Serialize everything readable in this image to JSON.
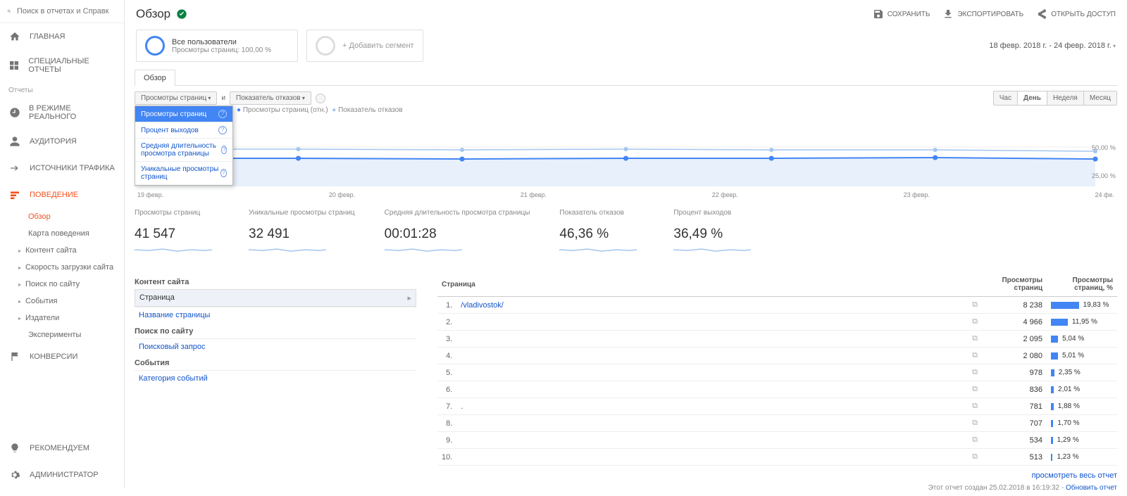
{
  "search_placeholder": "Поиск в отчетах и Справк",
  "sidebar": {
    "home": "ГЛАВНАЯ",
    "custom": "СПЕЦИАЛЬНЫЕ ОТЧЕТЫ",
    "reports_label": "Отчеты",
    "realtime": "В РЕЖИМЕ РЕАЛЬНОГО",
    "audience": "АУДИТОРИЯ",
    "acquisition": "ИСТОЧНИКИ ТРАФИКА",
    "behavior": "ПОВЕДЕНИЕ",
    "conversions": "КОНВЕРСИИ",
    "discover": "РЕКОМЕНДУЕМ",
    "admin": "АДМИНИСТРАТОР",
    "sub": {
      "overview": "Обзор",
      "flow": "Карта поведения",
      "content": "Контент сайта",
      "speed": "Скорость загрузки сайта",
      "search": "Поиск по сайту",
      "events": "События",
      "publisher": "Издатели",
      "experiments": "Эксперименты"
    }
  },
  "page_title": "Обзор",
  "actions": {
    "save": "СОХРАНИТЬ",
    "export": "ЭКСПОРТИРОВАТЬ",
    "share": "ОТКРЫТЬ ДОСТУП"
  },
  "segment": {
    "all_users": "Все пользователи",
    "sub": "Просмотры страниц: 100,00 %",
    "add": "+ Добавить сегмент"
  },
  "date_range": "18 февр. 2018 г. - 24 февр. 2018 г.",
  "tab": "Обзор",
  "metric1": "Просмотры страниц",
  "and": "и",
  "metric2": "Показатель отказов",
  "dropdown": [
    "Просмотры страниц",
    "Процент выходов",
    "Средняя длительность просмотра страницы",
    "Уникальные просмотры страниц"
  ],
  "granularity": {
    "hour": "Час",
    "day": "День",
    "week": "Неделя",
    "month": "Месяц"
  },
  "chart_legend": "Показатель отказов",
  "y_labels": {
    "top": "50,00 %",
    "mid": "25,00 %"
  },
  "chart_data": {
    "type": "line",
    "x": [
      "19 февр.",
      "20 февр.",
      "21 февр.",
      "22 февр.",
      "23 февр.",
      "24 фе."
    ],
    "series": [
      {
        "name": "Просмотры страниц (отн.)",
        "values": [
          36,
          36,
          35,
          36,
          36,
          37,
          35
        ],
        "color": "#4285f4"
      },
      {
        "name": "Показатель отказов, %",
        "values": [
          47,
          47,
          46,
          47,
          46,
          46,
          45
        ],
        "color": "#a3c7f0",
        "ylim": [
          0,
          100
        ]
      }
    ]
  },
  "scorecards": [
    {
      "label": "Просмотры страниц",
      "value": "41 547"
    },
    {
      "label": "Уникальные просмотры страниц",
      "value": "32 491"
    },
    {
      "label": "Средняя длительность просмотра страницы",
      "value": "00:01:28"
    },
    {
      "label": "Показатель отказов",
      "value": "46,36 %"
    },
    {
      "label": "Процент выходов",
      "value": "36,49 %"
    }
  ],
  "left": {
    "content_hd": "Контент сайта",
    "page": "Страница",
    "page_title": "Название страницы",
    "search_hd": "Поиск по сайту",
    "search_term": "Поисковый запрос",
    "events_hd": "События",
    "event_cat": "Категория событий"
  },
  "table": {
    "col_page": "Страница",
    "col_views": "Просмотры страниц",
    "col_pct": "Просмотры страниц, %",
    "rows": [
      {
        "n": "1.",
        "page": "/vladivostok/",
        "views": "8 238",
        "pct": "19,83 %",
        "bar": 19.83
      },
      {
        "n": "2.",
        "page": "",
        "views": "4 966",
        "pct": "11,95 %",
        "bar": 11.95
      },
      {
        "n": "3.",
        "page": "",
        "views": "2 095",
        "pct": "5,04 %",
        "bar": 5.04
      },
      {
        "n": "4.",
        "page": "",
        "views": "2 080",
        "pct": "5,01 %",
        "bar": 5.01
      },
      {
        "n": "5.",
        "page": "",
        "views": "978",
        "pct": "2,35 %",
        "bar": 2.35
      },
      {
        "n": "6.",
        "page": "",
        "views": "836",
        "pct": "2,01 %",
        "bar": 2.01
      },
      {
        "n": "7.",
        "page": ".",
        "views": "781",
        "pct": "1,88 %",
        "bar": 1.88
      },
      {
        "n": "8.",
        "page": "",
        "views": "707",
        "pct": "1,70 %",
        "bar": 1.7
      },
      {
        "n": "9.",
        "page": "",
        "views": "534",
        "pct": "1,29 %",
        "bar": 1.29
      },
      {
        "n": "10.",
        "page": "",
        "views": "513",
        "pct": "1,23 %",
        "bar": 1.23
      }
    ]
  },
  "full_report": "просмотреть весь отчет",
  "footer_generated": "Этот отчет создан 25.02.2018 в 16:19:32 - ",
  "footer_refresh": "Обновить отчет"
}
